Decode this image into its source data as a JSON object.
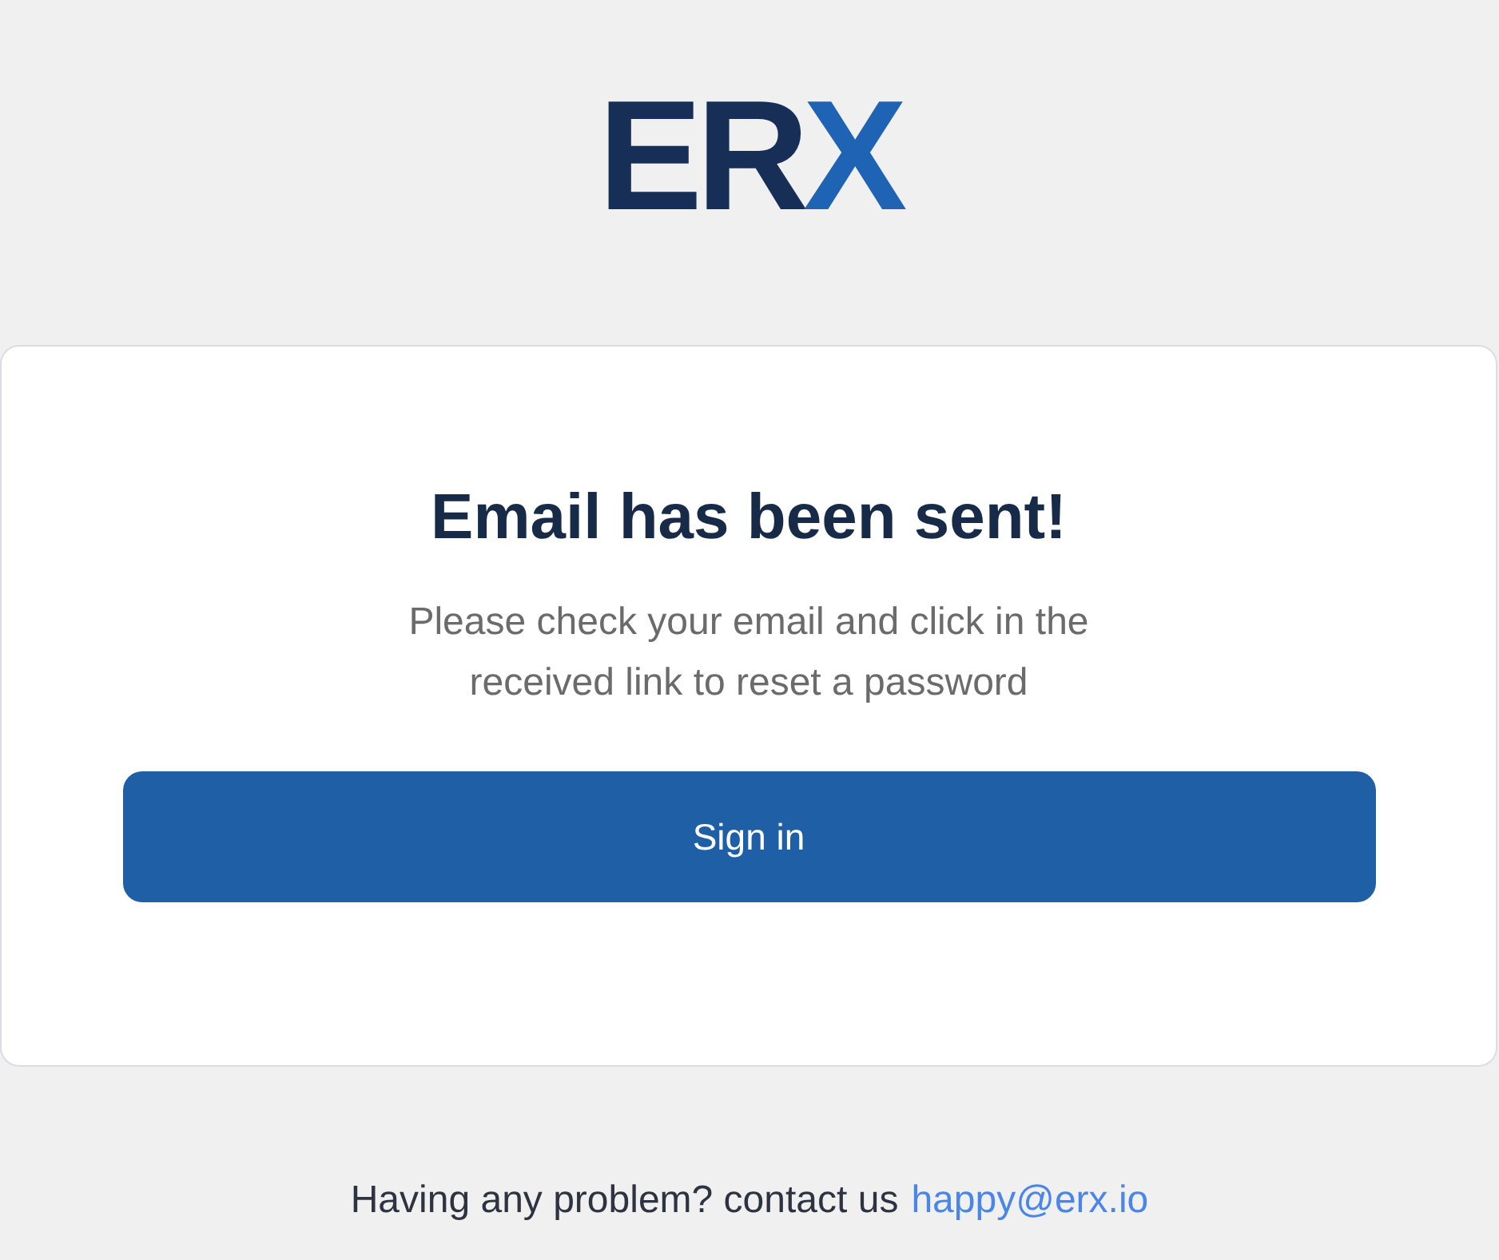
{
  "logo": {
    "primary": "ER",
    "accent": "X"
  },
  "card": {
    "title": "Email has been sent!",
    "message": "Please check your email and click in the received link to reset a password",
    "button": "Sign in"
  },
  "footer": {
    "text": "Having any problem? contact us",
    "link": "happy@erx.io"
  }
}
